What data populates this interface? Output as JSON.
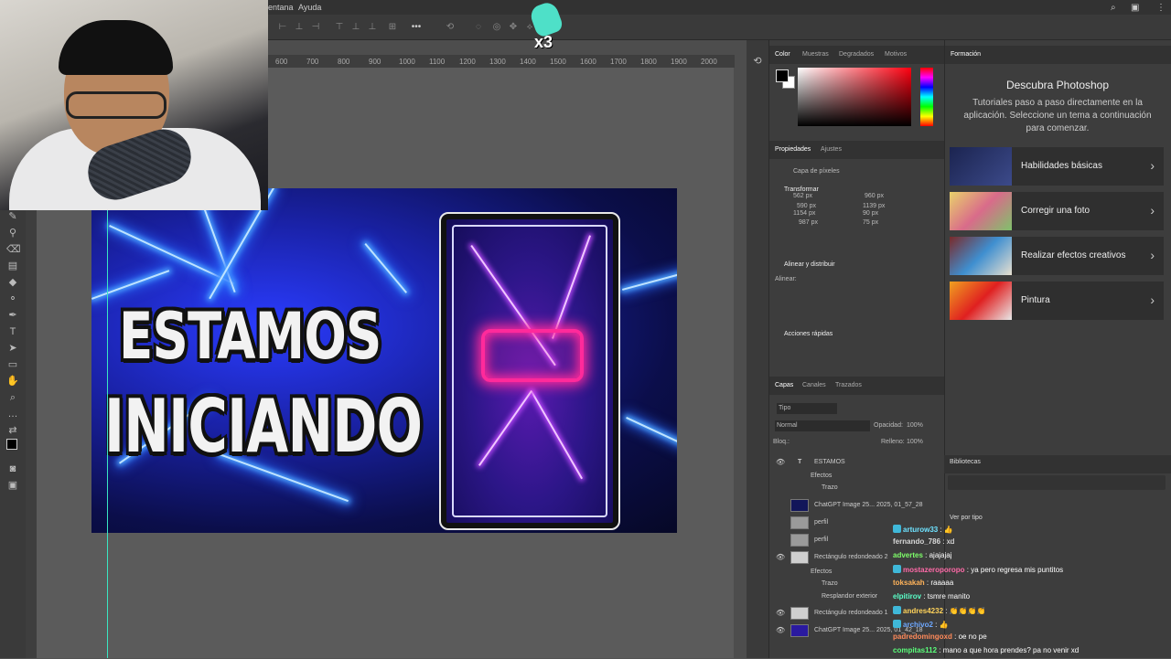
{
  "menu": {
    "items": [
      "entana",
      "Ayuda"
    ]
  },
  "ruler": {
    "ticks": [
      "600",
      "700",
      "800",
      "900",
      "1000",
      "1100",
      "1200",
      "1300",
      "1400",
      "1500",
      "1600",
      "1700",
      "1800",
      "1900",
      "2000"
    ]
  },
  "badge": {
    "count": "x3"
  },
  "canvas": {
    "line1": "ESTAMOS",
    "line2": "INICIANDO"
  },
  "color_panel": {
    "tabs": [
      "Color",
      "Muestras",
      "Degradados",
      "Motivos"
    ]
  },
  "properties": {
    "tabs": [
      "Propiedades",
      "Ajustes"
    ],
    "layer_type": "Capa de píxeles",
    "transform_label": "Transformar",
    "w": "562 px",
    "h": "960 px",
    "an": "590 px",
    "al": "1139 px",
    "x": "1154 px",
    "y": "90 px",
    "x2": "987 px",
    "y2": "75 px",
    "align_title": "Alinear y distribuir",
    "align_sub": "Alinear:",
    "quick_actions": "Acciones rápidas"
  },
  "layers": {
    "tabs": [
      "Capas",
      "Canales",
      "Trazados"
    ],
    "filter": "Tipo",
    "blend": "Normal",
    "opacity_label": "Opacidad:",
    "opacity": "100%",
    "lock_label": "Bloq.:",
    "fill_label": "Relleno:",
    "fill": "100%",
    "items": [
      {
        "name": "ESTAMOS"
      },
      {
        "name": "Efectos"
      },
      {
        "name": "Trazo"
      },
      {
        "name": "ChatGPT Image 25... 2025, 01_57_28"
      },
      {
        "name": "perfil"
      },
      {
        "name": "perfil"
      },
      {
        "name": "Rectángulo redondeado 2"
      },
      {
        "name": "Efectos"
      },
      {
        "name": "Trazo"
      },
      {
        "name": "Resplandor exterior"
      },
      {
        "name": "Rectángulo redondeado 1"
      },
      {
        "name": "ChatGPT Image 25... 2025, 01_42_18"
      }
    ]
  },
  "learn": {
    "tab": "Formación",
    "title": "Descubra Photoshop",
    "description": "Tutoriales paso a paso directamente en la aplicación. Seleccione un tema a continuación para comenzar.",
    "cards": [
      {
        "label": "Habilidades básicas"
      },
      {
        "label": "Corregir una foto"
      },
      {
        "label": "Realizar efectos creativos"
      },
      {
        "label": "Pintura"
      }
    ]
  },
  "libraries": {
    "title": "Bibliotecas",
    "view_by": "Ver por tipo"
  },
  "chat": [
    {
      "user": "arturow33",
      "msg": "👍",
      "color": "#6ee2ff"
    },
    {
      "user": "fernando_786",
      "msg": "xd",
      "color": "#d8d8d8"
    },
    {
      "user": "advertes",
      "msg": "ajajajaj",
      "color": "#7fff6a"
    },
    {
      "user": "mostazeroporopo",
      "msg": "ya pero regresa mis puntitos",
      "color": "#ff6aa8"
    },
    {
      "user": "toksakah",
      "msg": "raaaaa",
      "color": "#ffb35a"
    },
    {
      "user": "elpitirov",
      "msg": "tsmre manito",
      "color": "#5affc8"
    },
    {
      "user": "andres4232",
      "msg": "👏👏👏👏",
      "color": "#ffd35a"
    },
    {
      "user": "archivo2",
      "msg": "👍",
      "color": "#6ea8ff"
    },
    {
      "user": "padredomingoxd",
      "msg": "oe no pe",
      "color": "#ff8a5a"
    },
    {
      "user": "compitas112",
      "msg": "mano a que hora prendes? pa no venir xd",
      "color": "#5aff7a"
    }
  ]
}
